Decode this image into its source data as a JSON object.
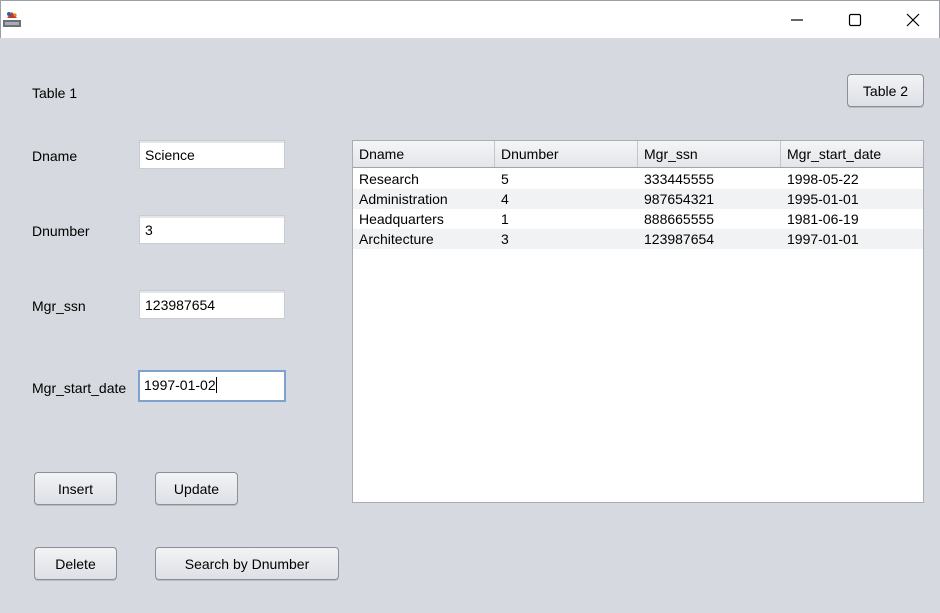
{
  "window": {
    "icons": {
      "app": "java-app-icon",
      "minimize": "minimize-icon",
      "maximize": "maximize-icon",
      "close": "close-icon"
    }
  },
  "form": {
    "heading": "Table 1",
    "fields": [
      {
        "label": "Dname",
        "value": "Science"
      },
      {
        "label": "Dnumber",
        "value": "3"
      },
      {
        "label": "Mgr_ssn",
        "value": "123987654"
      },
      {
        "label": "Mgr_start_date",
        "value": "1997-01-02"
      }
    ],
    "buttons": {
      "insert": "Insert",
      "update": "Update",
      "delete": "Delete",
      "search": "Search by Dnumber",
      "table2": "Table 2"
    }
  },
  "table": {
    "columns": [
      "Dname",
      "Dnumber",
      "Mgr_ssn",
      "Mgr_start_date"
    ],
    "rows": [
      [
        "Research",
        "5",
        "333445555",
        "1998-05-22"
      ],
      [
        "Administration",
        "4",
        "987654321",
        "1995-01-01"
      ],
      [
        "Headquarters",
        "1",
        "888665555",
        "1981-06-19"
      ],
      [
        "Architecture",
        "3",
        "123987654",
        "1997-01-01"
      ]
    ]
  },
  "colors": {
    "background": "#d6d9df",
    "focus_border": "#7da2ce",
    "alt_row": "#f1f2f4"
  }
}
